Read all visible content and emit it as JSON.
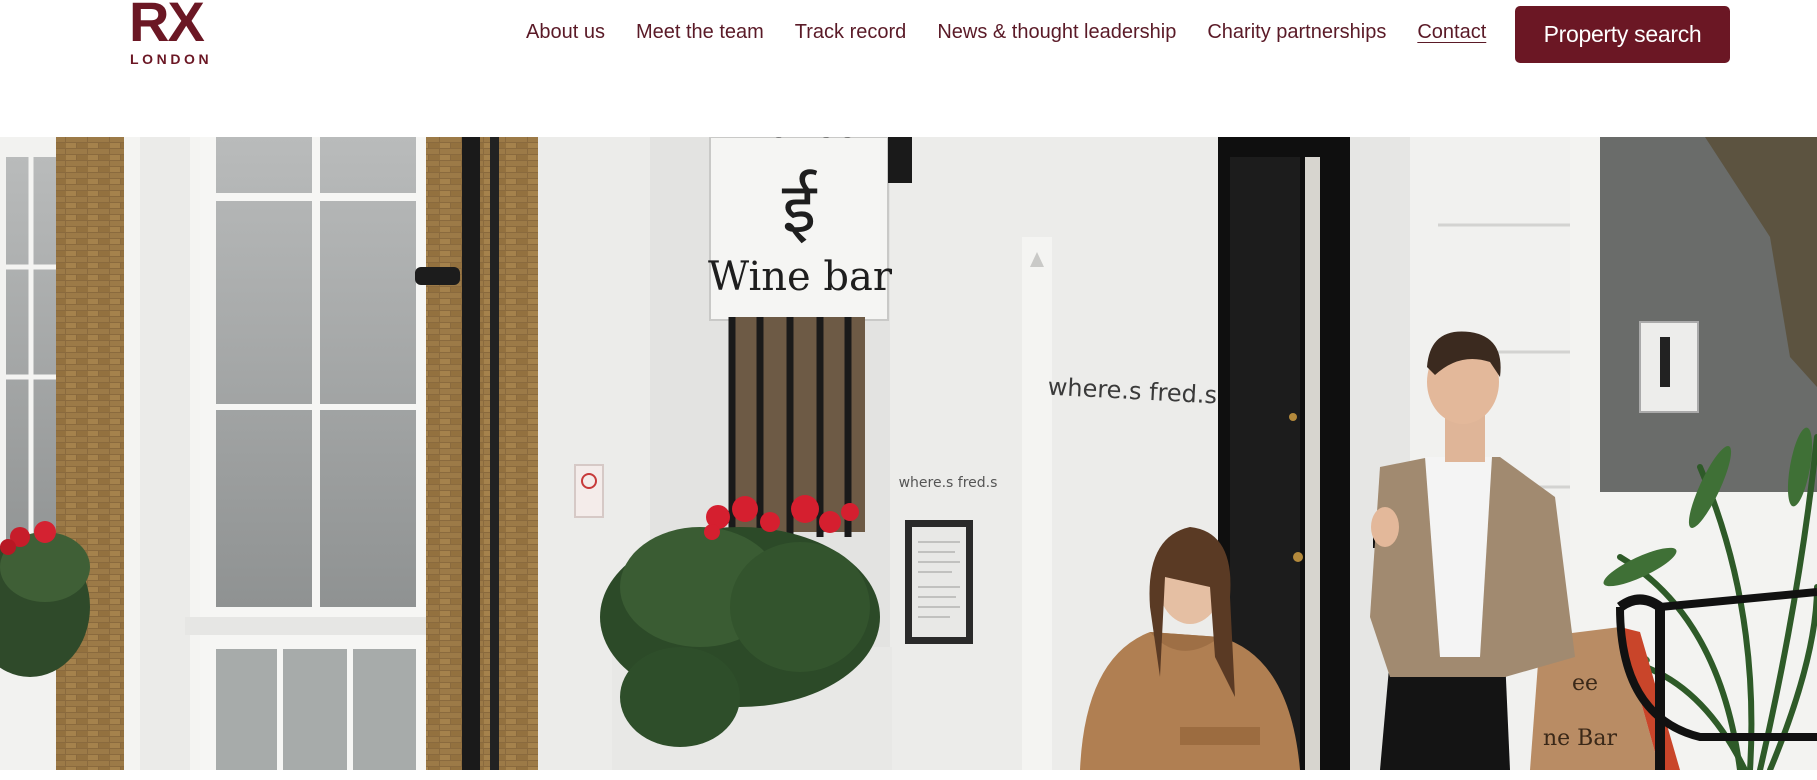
{
  "brand": {
    "logo_mark": "RX",
    "logo_sub": "LONDON",
    "color": "#6b1724"
  },
  "nav": {
    "items": [
      {
        "label": "About us"
      },
      {
        "label": "Meet the team"
      },
      {
        "label": "Track record"
      },
      {
        "label": "News & thought leadership"
      },
      {
        "label": "Charity partnerships"
      },
      {
        "label": "Contact",
        "current": true
      }
    ]
  },
  "cta": {
    "label": "Property search"
  },
  "hero": {
    "sign_text": "Wine bar",
    "sign_glyph": "ई",
    "sign_top": "Coffee",
    "wall_text_large": "where.s fred.s",
    "wall_text_small": "where.s fred.s",
    "aframe_line1": "ee",
    "aframe_line2": "ne Bar"
  }
}
